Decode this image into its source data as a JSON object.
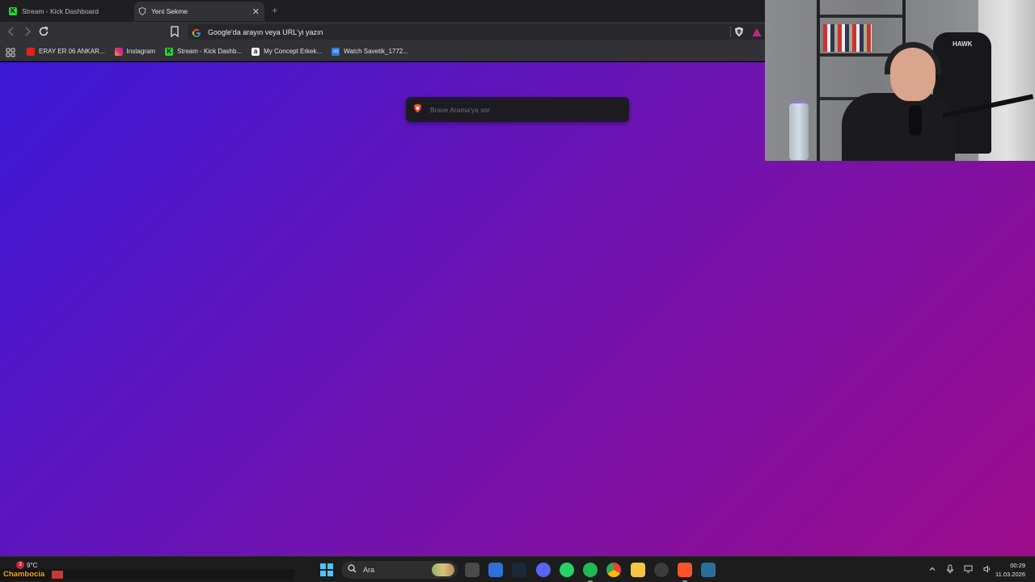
{
  "browser": {
    "tabs": [
      {
        "title": "Stream - Kick Dashboard",
        "active": false
      },
      {
        "title": "Yeni Sekme",
        "active": true
      }
    ],
    "new_tab_symbol": "+",
    "close_symbol": "✕",
    "address_bar": {
      "placeholder": "Google'da arayın veya URL'yi yazın"
    },
    "bookmarks": [
      {
        "label": "ERAY ER 06 ANKAR...",
        "icon": "youtube-icon"
      },
      {
        "label": "Instagram",
        "icon": "instagram-icon"
      },
      {
        "label": "Stream - Kick Dashb...",
        "icon": "kick-icon"
      },
      {
        "label": "My Concept Erkek...",
        "icon": "amazon-icon"
      },
      {
        "label": "Watch Savetik_1772...",
        "icon": "co-icon"
      }
    ]
  },
  "page": {
    "search_placeholder": "Brave Arama'ya sor",
    "gradient_colors": [
      "#3a18d6",
      "#6a14b4",
      "#9c0c8a"
    ]
  },
  "taskbar": {
    "weather": {
      "temp": "9°C",
      "badge": "3"
    },
    "channel_overlay": "Chambocia",
    "search_label": "Ara",
    "clock": {
      "time": "00:29",
      "date": "11.03.2026"
    },
    "accent": "#4cc2ff"
  },
  "webcam": {
    "chair_brand": "HAWK"
  }
}
